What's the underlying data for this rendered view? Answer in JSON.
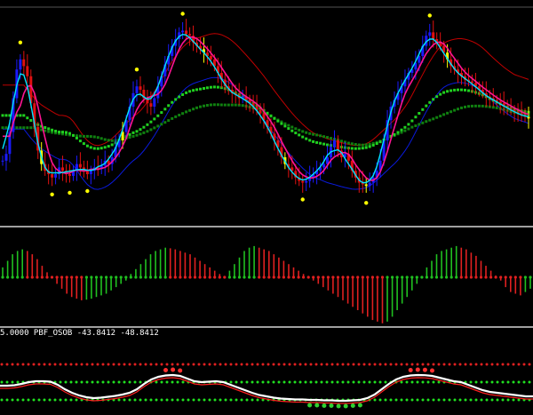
{
  "colors": {
    "background": "#000000",
    "separator": "#a0a0a0",
    "bull_candle": "#1a1aff",
    "bear_candle": "#e01010",
    "doji_candle": "#ffff00",
    "fast_ma": "#00e5ff",
    "slow_ma": "#ff1493",
    "band_blue": "#0a1adc",
    "band_red": "#c00000",
    "ma_green": "#20d020",
    "ma_darkgreen": "#108010",
    "ma_red": "#c02020",
    "fractal": "#ffff00",
    "hist_green": "#20c020",
    "hist_red": "#e02020",
    "osc_line": "#ffffff",
    "osc_signal": "#ff2020",
    "osc_dots_green": "#20e020",
    "osc_dots_red": "#e02020"
  },
  "indicator_label": {
    "text": "5.0000  PBF_OSOB -43.8412 -48.8412"
  },
  "chart_data": [
    {
      "type": "candlestick",
      "name": "price",
      "x": [
        0,
        1,
        2,
        3,
        4,
        5,
        6,
        7,
        8,
        9,
        10,
        11,
        12,
        13,
        14,
        15,
        16,
        17,
        18,
        19,
        20,
        21,
        22,
        23,
        24,
        25,
        26,
        27,
        28,
        29,
        30,
        31,
        32,
        33,
        34,
        35,
        36,
        37,
        38,
        39,
        40,
        41,
        42,
        43,
        44,
        45,
        46,
        47,
        48,
        49,
        50,
        51,
        52,
        53,
        54,
        55,
        56,
        57,
        58,
        59,
        60,
        61,
        62,
        63,
        64,
        65,
        66,
        67,
        68,
        69,
        70,
        71,
        72,
        73,
        74,
        75,
        76,
        77,
        78,
        79,
        80,
        81,
        82,
        83,
        84,
        85,
        86,
        87,
        88,
        89,
        90,
        91,
        92,
        93,
        94,
        95,
        96,
        97,
        98,
        99,
        100,
        101,
        102,
        103,
        104,
        105,
        106,
        107,
        108,
        109,
        110,
        111,
        112,
        113,
        114,
        115,
        116,
        117,
        118,
        119,
        120,
        121,
        122,
        123,
        124,
        125,
        126,
        127,
        128,
        129,
        130,
        131,
        132,
        133,
        134,
        135,
        136,
        137,
        138,
        139,
        140,
        141,
        142,
        143,
        144,
        145,
        146,
        147,
        148,
        149
      ],
      "close": [
        0.18,
        0.22,
        0.35,
        0.55,
        0.72,
        0.78,
        0.74,
        0.68,
        0.52,
        0.38,
        0.24,
        0.16,
        0.12,
        0.1,
        0.08,
        0.1,
        0.14,
        0.12,
        0.1,
        0.09,
        0.12,
        0.16,
        0.14,
        0.12,
        0.1,
        0.12,
        0.14,
        0.13,
        0.15,
        0.18,
        0.16,
        0.2,
        0.26,
        0.3,
        0.35,
        0.42,
        0.5,
        0.58,
        0.62,
        0.6,
        0.55,
        0.52,
        0.5,
        0.55,
        0.62,
        0.68,
        0.75,
        0.8,
        0.86,
        0.9,
        0.94,
        0.95,
        0.93,
        0.92,
        0.88,
        0.86,
        0.84,
        0.82,
        0.8,
        0.78,
        0.74,
        0.7,
        0.66,
        0.62,
        0.6,
        0.58,
        0.57,
        0.55,
        0.56,
        0.54,
        0.52,
        0.5,
        0.48,
        0.46,
        0.42,
        0.38,
        0.34,
        0.3,
        0.26,
        0.2,
        0.16,
        0.14,
        0.12,
        0.08,
        0.06,
        0.05,
        0.06,
        0.08,
        0.1,
        0.12,
        0.14,
        0.16,
        0.2,
        0.26,
        0.3,
        0.24,
        0.2,
        0.22,
        0.18,
        0.12,
        0.08,
        0.05,
        0.04,
        0.03,
        0.05,
        0.08,
        0.12,
        0.18,
        0.3,
        0.42,
        0.5,
        0.54,
        0.58,
        0.62,
        0.66,
        0.7,
        0.72,
        0.76,
        0.8,
        0.86,
        0.92,
        0.94,
        0.9,
        0.88,
        0.86,
        0.82,
        0.78,
        0.74,
        0.72,
        0.7,
        0.68,
        0.66,
        0.65,
        0.64,
        0.62,
        0.6,
        0.58,
        0.56,
        0.55,
        0.54,
        0.53,
        0.52,
        0.5,
        0.49,
        0.48,
        0.47,
        0.46,
        0.45,
        0.44,
        0.43
      ]
    },
    {
      "type": "bar",
      "name": "histogram",
      "values": [
        0.3,
        0.5,
        0.7,
        0.8,
        0.85,
        0.8,
        0.7,
        0.55,
        0.35,
        0.15,
        0.0,
        -0.2,
        -0.35,
        -0.5,
        -0.6,
        -0.65,
        -0.7,
        -0.68,
        -0.65,
        -0.6,
        -0.55,
        -0.5,
        -0.4,
        -0.3,
        -0.2,
        -0.1,
        0.1,
        0.25,
        0.4,
        0.55,
        0.7,
        0.8,
        0.85,
        0.9,
        0.88,
        0.85,
        0.8,
        0.75,
        0.7,
        0.6,
        0.5,
        0.4,
        0.3,
        0.2,
        0.1,
        0.0,
        0.2,
        0.4,
        0.6,
        0.8,
        0.9,
        0.95,
        0.9,
        0.85,
        0.8,
        0.7,
        0.6,
        0.5,
        0.4,
        0.3,
        0.2,
        0.1,
        0.0,
        -0.1,
        -0.2,
        -0.3,
        -0.4,
        -0.5,
        -0.6,
        -0.7,
        -0.8,
        -0.9,
        -1.0,
        -1.1,
        -1.2,
        -1.3,
        -1.35,
        -1.4,
        -1.35,
        -1.2,
        -1.0,
        -0.8,
        -0.6,
        -0.4,
        -0.2,
        0.0,
        0.3,
        0.5,
        0.7,
        0.8,
        0.85,
        0.9,
        0.95,
        0.9,
        0.85,
        0.75,
        0.65,
        0.5,
        0.35,
        0.2,
        0.05,
        -0.1,
        -0.3,
        -0.45,
        -0.5,
        -0.55,
        -0.45,
        -0.35
      ]
    },
    {
      "type": "line",
      "name": "PBF_OSOB",
      "values": [
        -0.4,
        -0.4,
        -0.35,
        -0.2,
        0.0,
        0.1,
        0.1,
        0.05,
        -0.3,
        -0.8,
        -1.2,
        -1.5,
        -1.7,
        -1.8,
        -1.75,
        -1.65,
        -1.55,
        -1.4,
        -1.2,
        -0.8,
        -0.2,
        0.3,
        0.6,
        0.75,
        0.8,
        0.7,
        0.4,
        0.1,
        0.0,
        0.05,
        0.1,
        0.0,
        -0.3,
        -0.6,
        -0.9,
        -1.2,
        -1.45,
        -1.6,
        -1.75,
        -1.85,
        -1.9,
        -1.95,
        -1.95,
        -2.0,
        -2.0,
        -2.05,
        -2.05,
        -2.1,
        -2.1,
        -2.05,
        -2.0,
        -1.8,
        -1.4,
        -0.8,
        -0.2,
        0.3,
        0.6,
        0.75,
        0.8,
        0.78,
        0.7,
        0.5,
        0.3,
        0.1,
        0.0,
        -0.3,
        -0.6,
        -0.9,
        -1.1,
        -1.2,
        -1.3,
        -1.4,
        -1.5,
        -1.6,
        -1.6
      ]
    }
  ]
}
